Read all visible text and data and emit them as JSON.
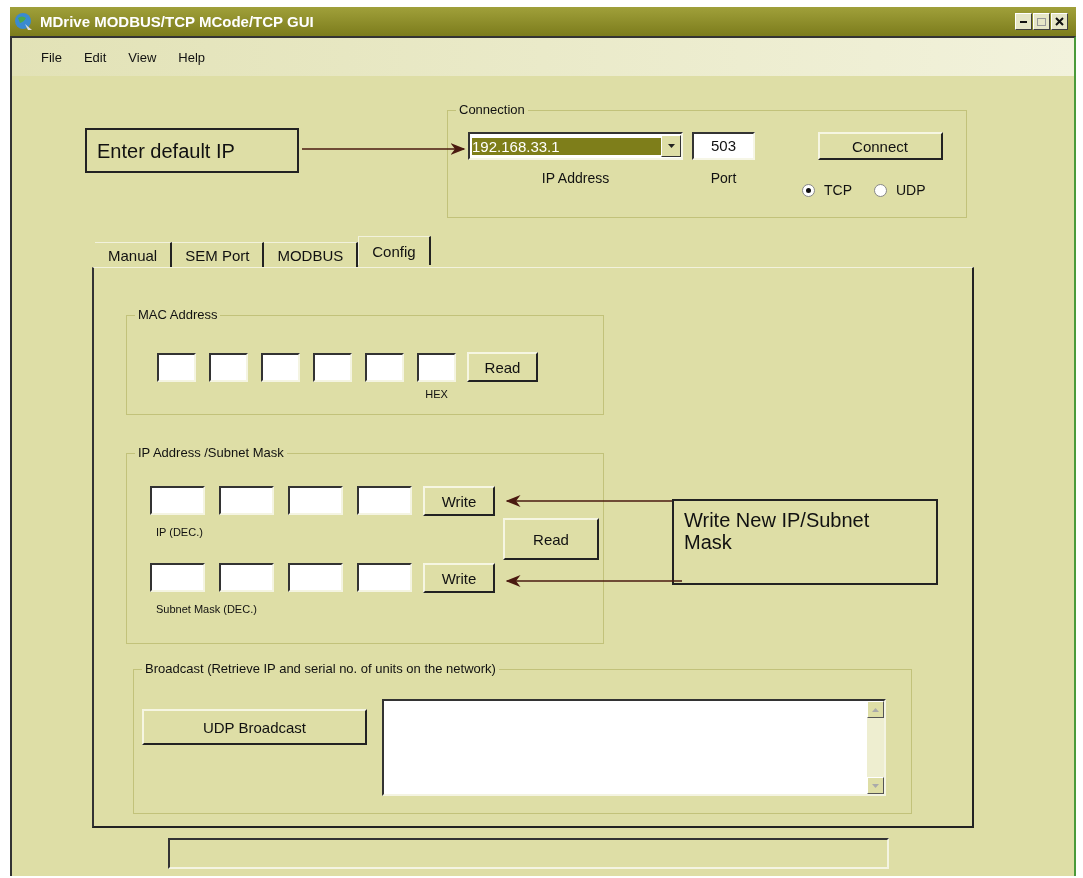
{
  "window": {
    "title": "MDrive MODBUS/TCP MCode/TCP GUI"
  },
  "menu": [
    "File",
    "Edit",
    "View",
    "Help"
  ],
  "connection": {
    "legend": "Connection",
    "ip_address": "192.168.33.1",
    "ip_label": "IP Address",
    "port": "503",
    "port_label": "Port",
    "connect_button": "Connect",
    "protocols": [
      {
        "label": "TCP",
        "selected": true
      },
      {
        "label": "UDP",
        "selected": false
      }
    ]
  },
  "annotations": [
    {
      "text": "Enter default IP"
    },
    {
      "text": "Write New IP/Subnet Mask"
    }
  ],
  "tabs": [
    {
      "label": "Manual",
      "selected": false
    },
    {
      "label": "SEM Port",
      "selected": false
    },
    {
      "label": "MODBUS",
      "selected": false
    },
    {
      "label": "Config",
      "selected": true
    }
  ],
  "mac_address": {
    "legend": "MAC Address",
    "read_button": "Read",
    "hint": "HEX"
  },
  "ip_subnet": {
    "legend": "IP Address /Subnet Mask",
    "read_button": "Read",
    "rows": [
      {
        "label": "IP (DEC.)",
        "write_button": "Write"
      },
      {
        "label": "Subnet Mask (DEC.)",
        "write_button": "Write"
      }
    ]
  },
  "broadcast": {
    "legend": "Broadcast (Retrieve IP and serial no. of units on the network)",
    "button": "UDP Broadcast"
  }
}
